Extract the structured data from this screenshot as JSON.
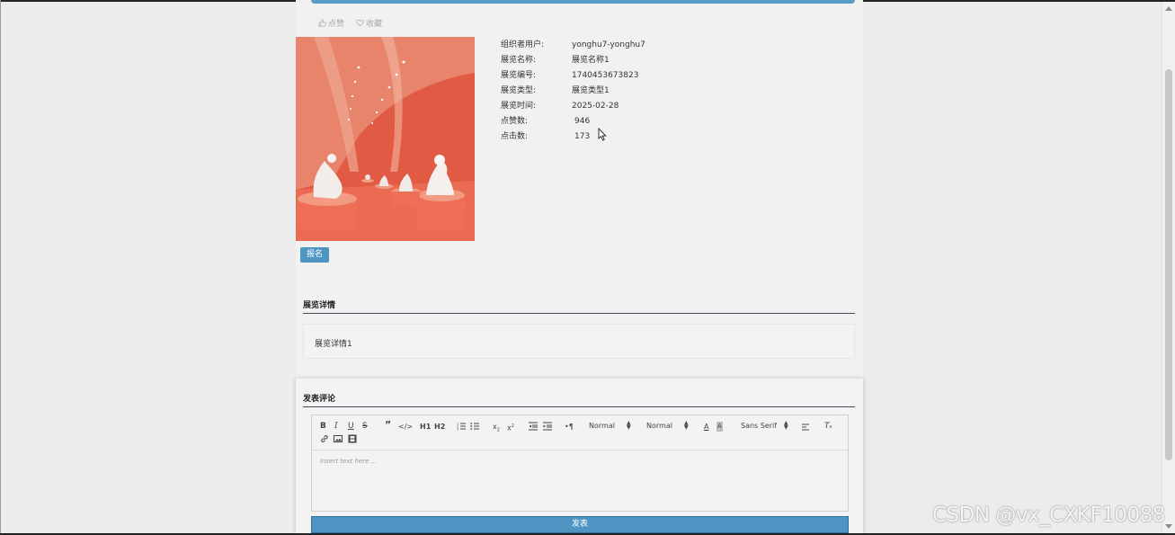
{
  "actions": {
    "like_label": "点赞",
    "favorite_label": "收藏"
  },
  "exhibition": {
    "rows": [
      {
        "label": "组织者用户:",
        "value": "yonghu7-yonghu7"
      },
      {
        "label": "展览名称:",
        "value": "展览名称1"
      },
      {
        "label": "展览编号:",
        "value": "1740453673823"
      },
      {
        "label": "展览类型:",
        "value": "展览类型1"
      },
      {
        "label": "展览时间:",
        "value": "2025-02-28"
      },
      {
        "label": "点赞数:",
        "value": "946"
      },
      {
        "label": "点击数:",
        "value": "173"
      }
    ],
    "signup_label": "报名"
  },
  "detail": {
    "title": "展览详情",
    "content": "展览详情1"
  },
  "comment": {
    "title": "发表评论",
    "toolbar": {
      "header_select": "Normal",
      "size_select": "Normal",
      "font_select": "Sans Serif",
      "h1": "H1",
      "h2": "H2"
    },
    "placeholder": "Insert text here ...",
    "submit_label": "发表"
  },
  "watermark": "CSDN @vx_CXKF10088",
  "colors": {
    "accent": "#4f95c4",
    "page_bg": "#f1f1f1",
    "photo_wall": "#e2543e"
  }
}
